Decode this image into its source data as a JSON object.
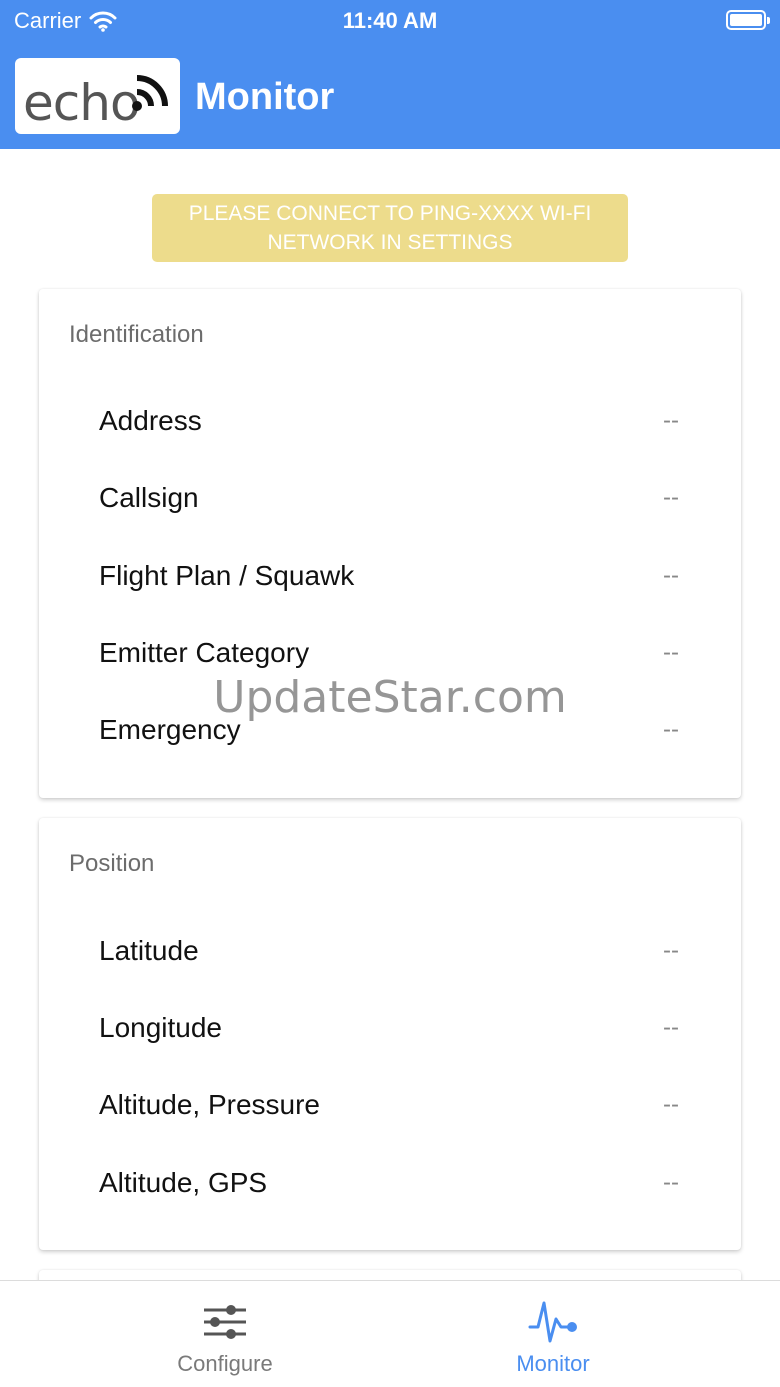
{
  "status_bar": {
    "carrier": "Carrier",
    "time": "11:40 AM"
  },
  "header": {
    "logo_text": "echo",
    "title": "Monitor"
  },
  "banner": {
    "line1": "PLEASE CONNECT TO PING-XXXX WI-FI",
    "line2": "NETWORK IN SETTINGS"
  },
  "identification": {
    "title": "Identification",
    "rows": [
      {
        "label": "Address",
        "value": "--"
      },
      {
        "label": "Callsign",
        "value": "--"
      },
      {
        "label": "Flight Plan / Squawk",
        "value": "--"
      },
      {
        "label": "Emitter Category",
        "value": "--"
      },
      {
        "label": "Emergency",
        "value": "--"
      }
    ]
  },
  "position": {
    "title": "Position",
    "rows": [
      {
        "label": "Latitude",
        "value": "--"
      },
      {
        "label": "Longitude",
        "value": "--"
      },
      {
        "label": "Altitude, Pressure",
        "value": "--"
      },
      {
        "label": "Altitude, GPS",
        "value": "--"
      }
    ]
  },
  "watermark": "UpdateStar.com",
  "tab_bar": {
    "tabs": [
      {
        "label": "Configure",
        "icon": "sliders-icon",
        "active": false
      },
      {
        "label": "Monitor",
        "icon": "pulse-icon",
        "active": true
      }
    ]
  },
  "colors": {
    "accent": "#4a8ef0",
    "banner": "#eddc8c",
    "text_muted": "#888888"
  }
}
